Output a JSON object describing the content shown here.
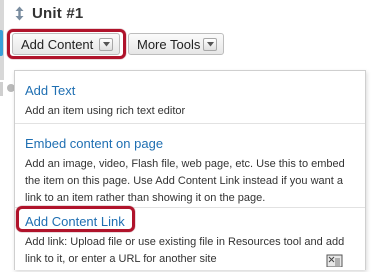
{
  "header": {
    "reorder_icon": "reorder-arrows-icon",
    "title": "Unit #1"
  },
  "toolbar": {
    "add_content_label": "Add Content",
    "more_tools_label": "More Tools",
    "dropdown_icon": "chevron-down-icon"
  },
  "menu": {
    "items": [
      {
        "title": "Add Text",
        "description": "Add an item using rich text editor"
      },
      {
        "title": "Embed content on page",
        "description": "Add an image, video, Flash file, web page, etc. Use this to embed the item on this page. Use Add Content Link instead if you want a link to an item rather than showing it on the page."
      },
      {
        "title": "Add Content Link",
        "description": "Add link: Upload file or use existing file in Resources tool and add link to it, or enter a URL for another site"
      }
    ]
  },
  "colors": {
    "highlight": "#b0132b",
    "link": "#1f6fb2",
    "accent": "#3aa0d8"
  },
  "cursor_icon": "busy-cursor-icon"
}
